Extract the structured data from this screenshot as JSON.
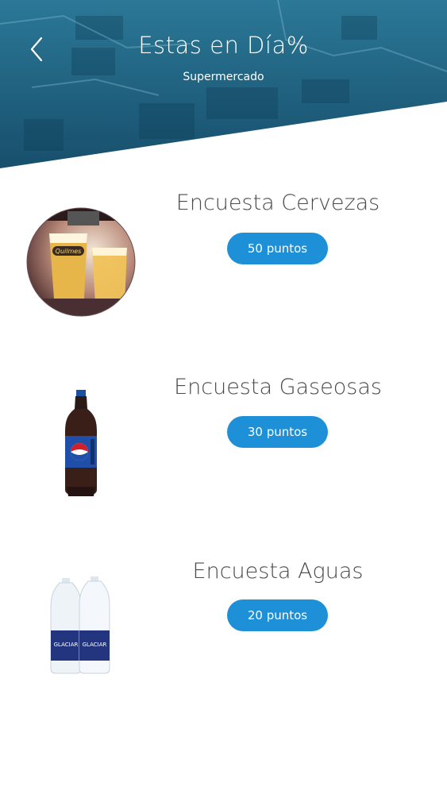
{
  "header": {
    "title": "Estas en Día%",
    "subtitle": "Supermercado",
    "background_color": "#1d5d7c"
  },
  "surveys": [
    {
      "title": "Encuesta Cervezas",
      "points_label": "50 puntos",
      "image": "beer-glasses-icon"
    },
    {
      "title": "Encuesta Gaseosas",
      "points_label": "30 puntos",
      "image": "soda-bottle-icon"
    },
    {
      "title": "Encuesta Aguas",
      "points_label": "20 puntos",
      "image": "water-bottles-icon"
    }
  ],
  "accent_color": "#1e90d8"
}
